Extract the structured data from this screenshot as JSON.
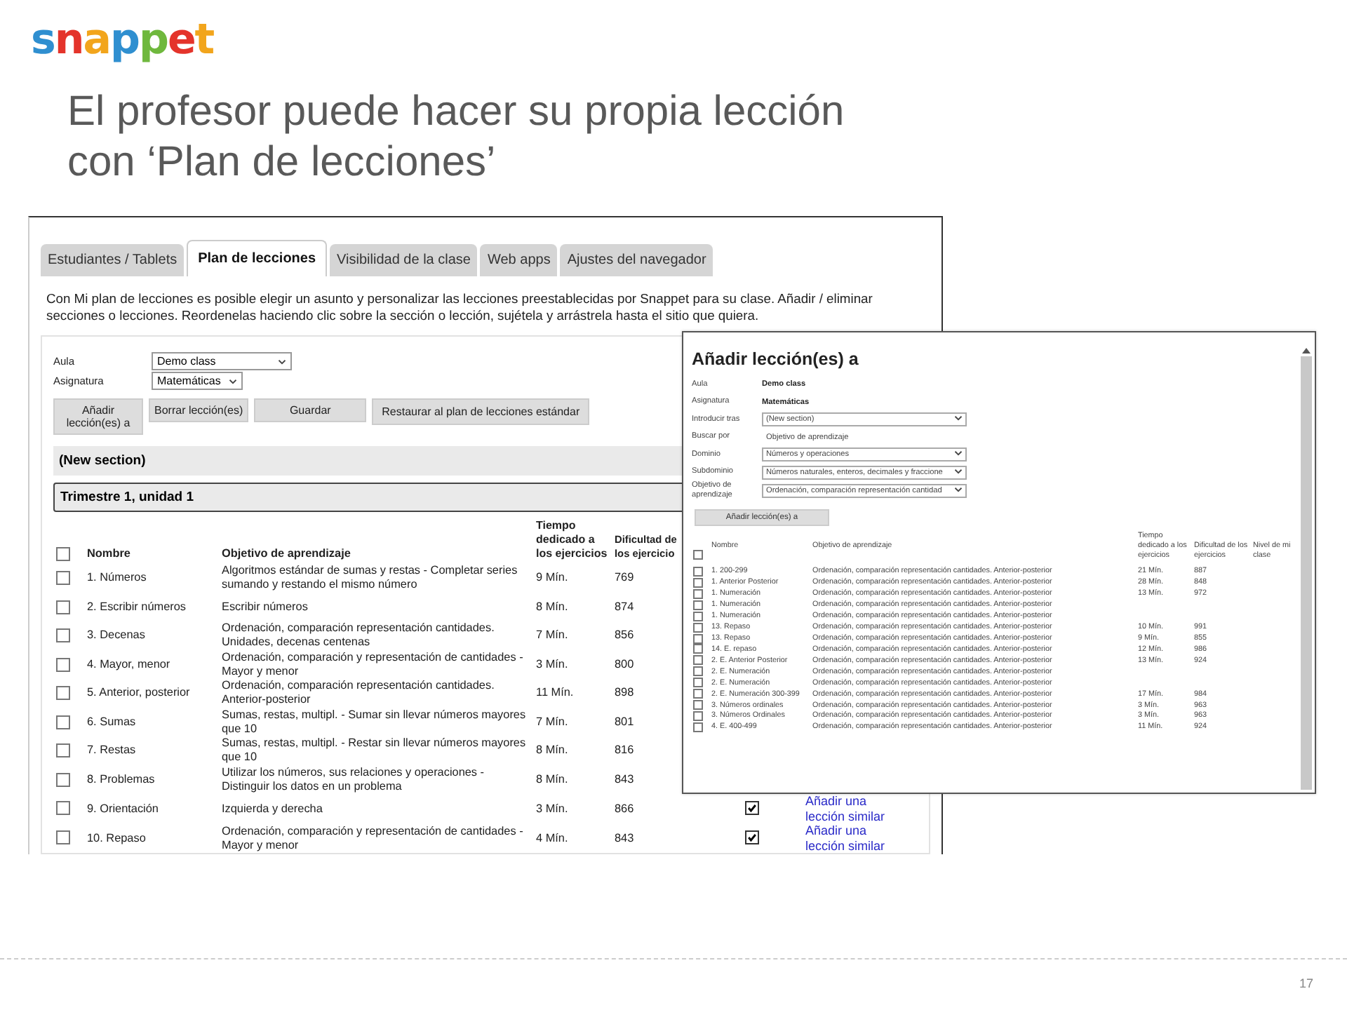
{
  "logo": {
    "text": "snappet"
  },
  "slide_title": {
    "lines": [
      "El profesor puede hacer su propia lección",
      "con ‘Plan de lecciones’"
    ]
  },
  "app": {
    "tabs": [
      {
        "label": "Estudiantes / Tablets",
        "selected": false
      },
      {
        "label": "Plan de lecciones",
        "selected": true
      },
      {
        "label": "Visibilidad de la clase",
        "selected": false
      },
      {
        "label": "Web apps",
        "selected": false
      },
      {
        "label": "Ajustes del navegador",
        "selected": false
      }
    ],
    "intro": "Con Mi plan de lecciones es posible elegir un asunto y personalizar las lecciones preestablecidas por Snappet para su clase. Añadir / eliminar secciones o lecciones. Reordenelas haciendo clic sobre la sección o lección, sujétela y arrástrela hasta el sitio que quiera.",
    "fields": [
      {
        "label": "Aula",
        "value": "Demo class"
      },
      {
        "label": "Asignatura",
        "value": "Matemáticas"
      }
    ],
    "buttons": [
      "Añadir lección(es) a",
      "Borrar lección(es)",
      "Guardar",
      "Restaurar al plan de lecciones estándar"
    ],
    "sections": [
      "(New section)",
      "Trimestre 1, unidad 1"
    ],
    "table": {
      "all_selected": false,
      "columns": [
        "Nombre",
        "Objetivo de aprendizaje",
        "Tiempo dedicado a los ejercicios",
        "Dificultad de los ejercicio"
      ],
      "rows": [
        {
          "selected": false,
          "name": "1. Números",
          "objective": "Algoritmos estándar de sumas y restas - Completar series sumando y restando el mismo número",
          "time": "9 Mín.",
          "difficulty": "769"
        },
        {
          "selected": false,
          "name": "2. Escribir números",
          "objective": "Escribir números",
          "time": "8 Mín.",
          "difficulty": "874"
        },
        {
          "selected": false,
          "name": "3. Decenas",
          "objective": "Ordenación, comparación representación cantidades. Unidades, decenas centenas",
          "time": "7 Mín.",
          "difficulty": "856"
        },
        {
          "selected": false,
          "name": "4. Mayor, menor",
          "objective": "Ordenación, comparación y representación de cantidades - Mayor y menor",
          "time": "3 Mín.",
          "difficulty": "800"
        },
        {
          "selected": false,
          "name": "5. Anterior, posterior",
          "objective": "Ordenación, comparación representación cantidades. Anterior-posterior",
          "time": "11 Mín.",
          "difficulty": "898"
        },
        {
          "selected": false,
          "name": "6. Sumas",
          "objective": "Sumas, restas, multipl. - Sumar sin llevar números mayores que 10",
          "time": "7 Mín.",
          "difficulty": "801"
        },
        {
          "selected": false,
          "name": "7. Restas",
          "objective": "Sumas, restas, multipl. - Restar sin llevar números mayores que 10",
          "time": "8 Mín.",
          "difficulty": "816"
        },
        {
          "selected": false,
          "name": "8. Problemas",
          "objective": "Utilizar los números, sus relaciones y operaciones - Distinguir los datos en un problema",
          "time": "8 Mín.",
          "difficulty": "843"
        },
        {
          "selected": false,
          "name": "9. Orientación",
          "objective": "Izquierda y derecha",
          "time": "3 Mín.",
          "difficulty": "866",
          "in_class": true,
          "link": "Añadir una lección similar"
        },
        {
          "selected": false,
          "name": "10. Repaso",
          "objective": "Ordenación, comparación y representación de cantidades - Mayor y menor",
          "time": "4 Mín.",
          "difficulty": "843",
          "in_class": true,
          "link": "Añadir una lección similar"
        }
      ]
    }
  },
  "dialog": {
    "title": "Añadir lección(es) a",
    "fields": [
      {
        "kind": "text",
        "label": "Aula",
        "value": "Demo class"
      },
      {
        "kind": "text",
        "label": "Asignatura",
        "value": "Matemáticas"
      },
      {
        "kind": "select",
        "label": "Introducir tras",
        "value": "(New section)"
      },
      {
        "kind": "plain",
        "label": "Buscar por",
        "value": "Objetivo de aprendizaje"
      },
      {
        "kind": "select",
        "label": "Dominio",
        "value": "Números y operaciones"
      },
      {
        "kind": "select",
        "label": "Subdominio",
        "value": "Números naturales, enteros, decimales y fraccione"
      },
      {
        "kind": "select",
        "label": "Objetivo de aprendizaje",
        "value": "Ordenación, comparación representación cantidad"
      }
    ],
    "button": "Añadir lección(es) a",
    "table": {
      "all_selected": false,
      "columns": [
        "Nombre",
        "Objetivo de aprendizaje",
        "Tiempo dedicado a los ejercicios",
        "Dificultad de los ejercicios",
        "Nivel de mi clase"
      ],
      "rows": [
        {
          "selected": false,
          "name": "1. 200-299",
          "objective": "Ordenación, comparación representación cantidades. Anterior-posterior",
          "time": "21 Mín.",
          "difficulty": "887"
        },
        {
          "selected": false,
          "name": "1. Anterior Posterior",
          "objective": "Ordenación, comparación representación cantidades. Anterior-posterior",
          "time": "28 Mín.",
          "difficulty": "848"
        },
        {
          "selected": false,
          "name": "1. Numeración",
          "objective": "Ordenación, comparación representación cantidades. Anterior-posterior",
          "time": "13 Mín.",
          "difficulty": "972"
        },
        {
          "selected": false,
          "name": "1. Numeración",
          "objective": "Ordenación, comparación representación cantidades. Anterior-posterior"
        },
        {
          "selected": false,
          "name": "1. Numeración",
          "objective": "Ordenación, comparación representación cantidades. Anterior-posterior"
        },
        {
          "selected": false,
          "name": "13. Repaso",
          "objective": "Ordenación, comparación representación cantidades. Anterior-posterior",
          "time": "10 Mín.",
          "difficulty": "991"
        },
        {
          "selected": false,
          "name": "13. Repaso",
          "objective": "Ordenación, comparación representación cantidades. Anterior-posterior",
          "time": "9 Mín.",
          "difficulty": "855"
        },
        {
          "selected": false,
          "name": "14. E. repaso",
          "objective": "Ordenación, comparación representación cantidades. Anterior-posterior",
          "time": "12 Mín.",
          "difficulty": "986"
        },
        {
          "selected": false,
          "name": "2. E. Anterior Posterior",
          "objective": "Ordenación, comparación representación cantidades. Anterior-posterior",
          "time": "13 Mín.",
          "difficulty": "924"
        },
        {
          "selected": false,
          "name": "2. E. Numeración",
          "objective": "Ordenación, comparación representación cantidades. Anterior-posterior"
        },
        {
          "selected": false,
          "name": "2. E. Numeración",
          "objective": "Ordenación, comparación representación cantidades. Anterior-posterior"
        },
        {
          "selected": false,
          "name": "2. E. Numeración 300-399",
          "objective": "Ordenación, comparación representación cantidades. Anterior-posterior",
          "time": "17 Mín.",
          "difficulty": "984"
        },
        {
          "selected": false,
          "name": "3. Números ordinales",
          "objective": "Ordenación, comparación representación cantidades. Anterior-posterior",
          "time": "3 Mín.",
          "difficulty": "963"
        },
        {
          "selected": false,
          "name": "3. Números Ordinales",
          "objective": "Ordenación, comparación representación cantidades. Anterior-posterior",
          "time": "3 Mín.",
          "difficulty": "963"
        },
        {
          "selected": false,
          "name": "4. E. 400-499",
          "objective": "Ordenación, comparación representación cantidades. Anterior-posterior",
          "time": "11 Mín.",
          "difficulty": "924"
        }
      ]
    }
  },
  "page_number": "17"
}
